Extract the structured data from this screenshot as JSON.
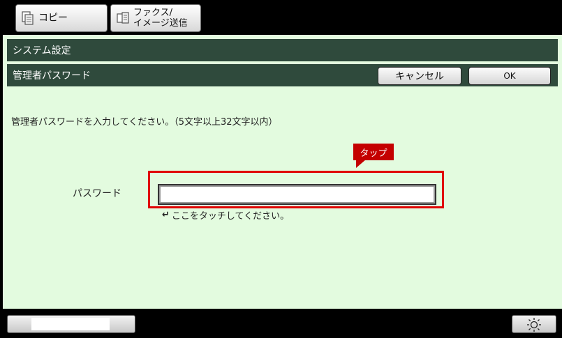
{
  "tabs": {
    "copy_label": "コピー",
    "fax_label_line1": "ファクス/",
    "fax_label_line2": "イメージ送信"
  },
  "header": {
    "system_title": "システム設定",
    "admin_title": "管理者パスワード",
    "cancel_label": "キャンセル",
    "ok_label": "OK"
  },
  "main": {
    "instruction": "管理者パスワードを入力してください。（5文字以上32文字以内）",
    "tap_label": "タップ",
    "field_label": "パスワード",
    "password_value": "",
    "hint_arrow": "↵",
    "hint_text": "ここをタッチしてください。"
  },
  "colors": {
    "panel_background": "#e3fbdf",
    "header_bar": "#2f4a3c",
    "highlight": "#e00000",
    "tap_callout": "#c40000"
  },
  "icons": {
    "copy": "copy-icon",
    "fax": "fax-icon",
    "brightness": "brightness-icon"
  }
}
